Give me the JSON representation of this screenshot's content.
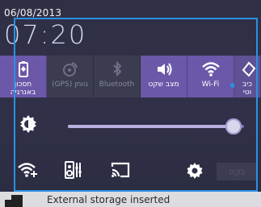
{
  "status": {
    "date": "06/08/2013",
    "time": "07:20"
  },
  "tiles": [
    {
      "label_lines": [
        "חסכון",
        "באנרגיה"
      ],
      "icon": "battery-saver-icon",
      "active": true
    },
    {
      "label_lines": [
        "(GPS) נוותן"
      ],
      "icon": "gps-icon",
      "active": false
    },
    {
      "label_lines": [
        "Bluetooth"
      ],
      "icon": "bluetooth-icon",
      "active": false
    },
    {
      "label_lines": [
        "מצב שקט"
      ],
      "icon": "sound-icon",
      "active": true
    },
    {
      "label_lines": [
        "Wi-Fi"
      ],
      "icon": "wifi-icon",
      "active": true
    },
    {
      "label_lines": [
        "כיב",
        "וטי"
      ],
      "icon": "rotate-icon",
      "active": true
    }
  ],
  "brightness": {
    "level": 0.94,
    "icon": "brightness-auto-icon"
  },
  "bottom_icons": [
    "wifi-settings-icon",
    "audio-settings-icon",
    "cast-screen-icon",
    "settings-gear-icon"
  ],
  "feedback_label": "נקה",
  "notification": {
    "text": "External storage inserted",
    "icon": "sd-card-icon"
  }
}
